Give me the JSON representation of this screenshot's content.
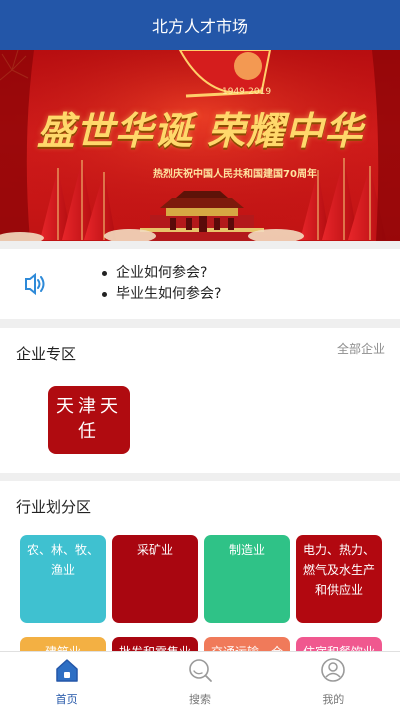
{
  "header": {
    "title": "北方人才市场"
  },
  "banner": {
    "years": "1949-2019",
    "slogan": "盛世华诞 荣耀中华",
    "subline": "热烈庆祝中国人民共和国建国70周年"
  },
  "notice": {
    "items": [
      "企业如何参会?",
      "毕业生如何参会?"
    ]
  },
  "enterprise": {
    "title": "企业专区",
    "all_link": "全部企业",
    "tiles": [
      {
        "label": "天津天任",
        "color": "#b00b10"
      }
    ]
  },
  "industry": {
    "title": "行业划分区",
    "tiles": [
      {
        "label": "农、林、牧、渔业",
        "color": "#3fc1d0"
      },
      {
        "label": "采矿业",
        "color": "#a90610"
      },
      {
        "label": "制造业",
        "color": "#2fc287"
      },
      {
        "label": "电力、热力、燃气及水生产和供应业",
        "color": "#b20810"
      },
      {
        "label": "建筑业",
        "color": "#f3b043"
      },
      {
        "label": "批发和零售业",
        "color": "#a90610"
      },
      {
        "label": "交通运输、仓储和邮政业",
        "color": "#f07a5a"
      },
      {
        "label": "住宿和餐饮业",
        "color": "#f0588f"
      }
    ]
  },
  "tabbar": {
    "items": [
      {
        "label": "首页",
        "icon": "home-icon",
        "active": true
      },
      {
        "label": "搜索",
        "icon": "search-icon",
        "active": false
      },
      {
        "label": "我的",
        "icon": "user-icon",
        "active": false
      }
    ]
  },
  "colors": {
    "primary": "#2356a8",
    "banner_red": "#c01313",
    "gold": "#ffd86b"
  }
}
